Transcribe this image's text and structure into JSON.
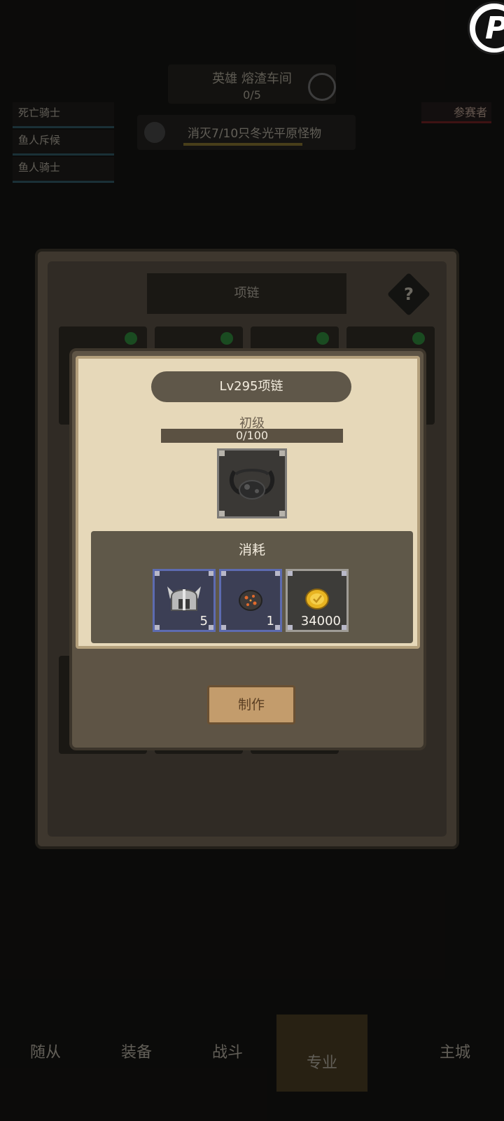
{
  "background": {
    "quest_title": "英雄 熔渣车间",
    "quest_progress": "0/5",
    "left_list": [
      "死亡骑士",
      "鱼人斥候",
      "鱼人骑士"
    ],
    "right_badge": "参赛者",
    "task_text": "消灭7/10只冬光平原怪物",
    "window_title": "项链",
    "help_label": "?",
    "nav": [
      "随从",
      "装备",
      "战斗",
      "专业",
      "主城"
    ]
  },
  "modal": {
    "title": "Lv295项链",
    "grade": "初级",
    "progress_text": "0/100",
    "progress_fraction": 0,
    "item_icon": "necklace-icon",
    "consume_header": "消耗",
    "materials": [
      {
        "icon": "helmet-icon",
        "qty": "5"
      },
      {
        "icon": "slag-ore-icon",
        "qty": "1"
      },
      {
        "icon": "gold-coin-icon",
        "qty": "34000"
      }
    ],
    "craft_label": "制作"
  },
  "colors": {
    "parchment": "#e6d8b9",
    "panel_dark": "#5f5849",
    "material_border": "#5d6bb0",
    "craft_button": "#c39c6c"
  }
}
